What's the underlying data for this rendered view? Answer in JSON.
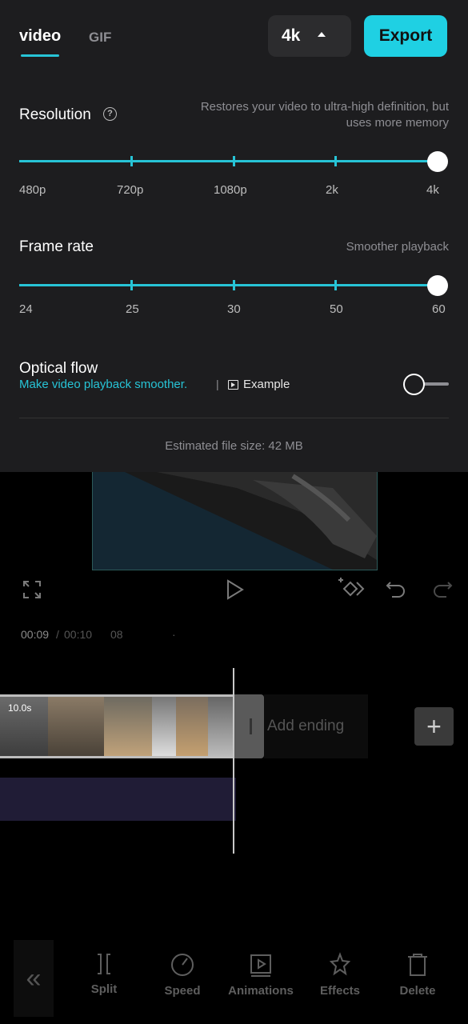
{
  "tabs": {
    "video": "video",
    "gif": "GIF"
  },
  "resolution_selector": {
    "value": "4k"
  },
  "export_label": "Export",
  "resolution": {
    "title": "Resolution",
    "hint_line1": "Restores your video to ultra-high definition, but",
    "hint_line2": "uses more memory",
    "options": [
      "480p",
      "720p",
      "1080p",
      "2k",
      "4k"
    ],
    "selected": "4k"
  },
  "frame_rate": {
    "title": "Frame rate",
    "hint": "Smoother playback",
    "options": [
      "24",
      "25",
      "30",
      "50",
      "60"
    ],
    "selected": "60"
  },
  "optical_flow": {
    "title": "Optical flow",
    "link": "Make video playback smoother.",
    "separator": "|",
    "example": "Example",
    "enabled": false
  },
  "file_size": "Estimated file size: 42 MB",
  "timeline": {
    "current": "00:09",
    "separator": "/",
    "total": "00:10",
    "marker": "08",
    "clip_duration": "10.0s",
    "add_ending": "Add ending"
  },
  "toolbar": {
    "items": [
      {
        "label": "Split",
        "icon": "split-icon"
      },
      {
        "label": "Speed",
        "icon": "speed-icon"
      },
      {
        "label": "Animations",
        "icon": "animations-icon"
      },
      {
        "label": "Effects",
        "icon": "effects-icon"
      },
      {
        "label": "Delete",
        "icon": "delete-icon"
      }
    ]
  },
  "colors": {
    "accent": "#27c4d6",
    "export_bg": "#1fd0e3",
    "panel_bg": "#1d1d1f"
  }
}
